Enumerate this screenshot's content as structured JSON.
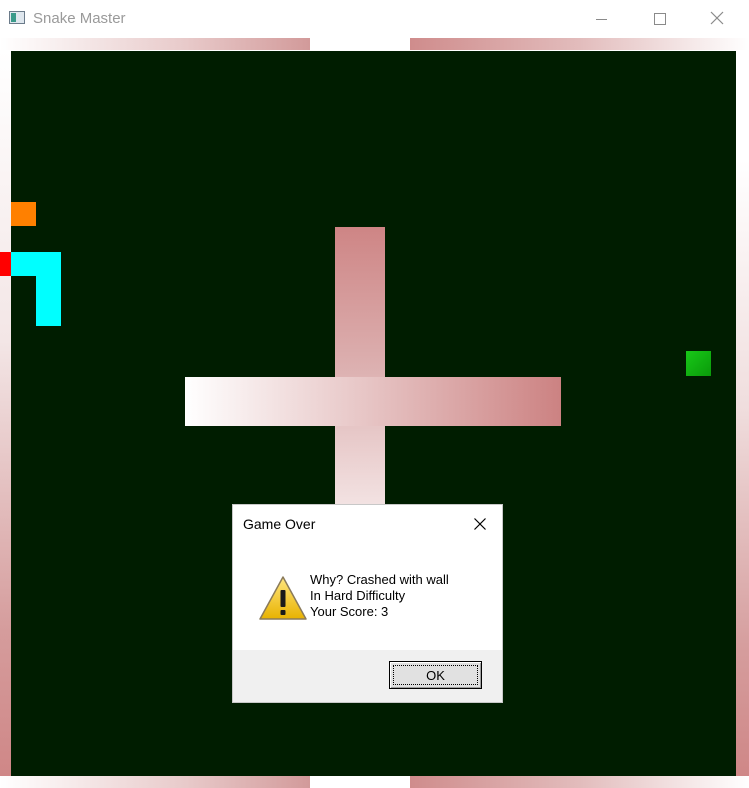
{
  "window": {
    "title": "Snake Master",
    "icon": "app-window-icon",
    "controls": [
      "minimize-icon",
      "maximize-icon",
      "close-icon"
    ]
  },
  "game": {
    "board_color": "#001d00",
    "snake": {
      "head_color": "#ff0000",
      "body_color": "#00ffff"
    },
    "food_color": "#ff8000",
    "bonus_color": "#00c000",
    "wall_colors": [
      "#ffffff",
      "#cc8282"
    ]
  },
  "dialog": {
    "title": "Game Over",
    "icon": "warning-icon",
    "message_lines": [
      "Why? Crashed with wall",
      "In Hard Difficulty",
      "Your Score: 3"
    ],
    "ok_label": "OK"
  }
}
